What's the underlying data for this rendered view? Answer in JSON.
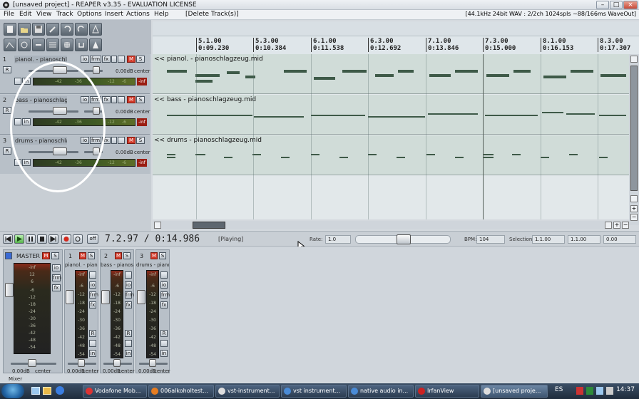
{
  "window": {
    "title": "[unsaved project] - REAPER v3.35 - EVALUATION LICENSE",
    "minimize_label": "–",
    "maximize_label": "□",
    "close_label": "×"
  },
  "menu": {
    "items": [
      "File",
      "Edit",
      "View",
      "Track",
      "Options",
      "Insert",
      "Actions",
      "Help"
    ],
    "action_hint": "[Delete Track(s)]",
    "audio_status": "[44.1kHz 24bit WAV : 2/2ch 1024spls ~88/166ms WaveOut]"
  },
  "ruler": {
    "markers": [
      {
        "bar": "5.1.00",
        "time": "0:09.230"
      },
      {
        "bar": "5.3.00",
        "time": "0:10.384"
      },
      {
        "bar": "6.1.00",
        "time": "0:11.538"
      },
      {
        "bar": "6.3.00",
        "time": "0:12.692"
      },
      {
        "bar": "7.1.00",
        "time": "0:13.846"
      },
      {
        "bar": "7.3.00",
        "time": "0:15.000"
      },
      {
        "bar": "8.1.00",
        "time": "0:16.153"
      },
      {
        "bar": "8.3.00",
        "time": "0:17.307"
      }
    ]
  },
  "tracks": [
    {
      "num": "1",
      "name": "pianol. - pianoschlagzeu",
      "volume": "0.00dB",
      "pan": "center",
      "item": "<< pianol. - pianoschlagzeug.mid",
      "inf": "-inf",
      "meter_ticks": [
        "-42",
        "-36",
        "-12",
        "-6"
      ]
    },
    {
      "num": "2",
      "name": "bass - pianoschlagzeu",
      "volume": "0.00dB",
      "pan": "center",
      "item": "<< bass - pianoschlagzeug.mid",
      "inf": "-inf",
      "meter_ticks": [
        "-42",
        "-36",
        "-12",
        "-6"
      ]
    },
    {
      "num": "3",
      "name": "drums - pianoschlagze",
      "volume": "0.00dB",
      "pan": "center",
      "item": "<< drums - pianoschlagzeug.mid",
      "inf": "-inf",
      "meter_ticks": [
        "-42",
        "-36",
        "-12",
        "-6"
      ]
    }
  ],
  "track_buttons": {
    "io": "io",
    "fx_env": "frm",
    "fx": "fx",
    "mute": "M",
    "solo": "S",
    "rec": "R",
    "input": "in"
  },
  "transport": {
    "time": "7.2.97 / 0:14.986",
    "state": "[Playing]",
    "rate_label": "Rate:",
    "rate_value": "1.0",
    "bpm_label": "BPM:",
    "bpm_value": "104",
    "selection_label": "Selection:",
    "sel_start": "1.1.00",
    "sel_end": "1.1.00",
    "sel_len": "0.00",
    "off_label": "off"
  },
  "mixer": {
    "master": {
      "name": "MASTER",
      "inf_l": "-inf",
      "inf_r": "-inf",
      "pan": "center",
      "vol": "0.00dB",
      "scale": [
        "12",
        "6",
        "-6",
        "-12",
        "-18",
        "-24",
        "-30",
        "-36",
        "-42",
        "-48",
        "-54",
        "-inf"
      ],
      "io": "io",
      "fx": "fx",
      "env": "frm"
    },
    "strips": [
      {
        "num": "1",
        "name": "pianol. - piano",
        "inf": "-inf",
        "vol": "0.00dB",
        "pan": "center"
      },
      {
        "num": "2",
        "name": "bass - pianos",
        "inf": "-inf",
        "vol": "0.00dB",
        "pan": "center"
      },
      {
        "num": "3",
        "name": "drums - piano",
        "inf": "-inf",
        "vol": "0.00dB",
        "pan": "center"
      }
    ],
    "strip_scale": [
      "-6",
      "-12",
      "-18",
      "-24",
      "-30",
      "-36",
      "-42",
      "-48",
      "-54"
    ],
    "label": "Mixer"
  },
  "taskbar": {
    "tasks": [
      {
        "label": "Vodafone Mob...",
        "color": "#d33"
      },
      {
        "label": "006alkoholtest...",
        "color": "#e67d22"
      },
      {
        "label": "vst-instrument...",
        "color": "#ddd"
      },
      {
        "label": "vst instrument...",
        "color": "#4a8bd6"
      },
      {
        "label": "native audio in...",
        "color": "#4a8bd6"
      },
      {
        "label": "IrfanView",
        "color": "#c22"
      },
      {
        "label": "[unsaved proje...",
        "color": "#ddd"
      }
    ],
    "lang": "ES",
    "clock": "14:37"
  },
  "colors": {
    "mute": "#d23a2a",
    "note": "#3e5a48",
    "annotation": "#ffffff"
  },
  "icons": [
    "new-project-icon",
    "open-icon",
    "save-icon",
    "settings-icon",
    "undo-icon",
    "redo-icon",
    "metronome-icon",
    "envelope-icon",
    "grid-icon",
    "snap-icon",
    "ripple-icon",
    "lock-icon",
    "loop-icon"
  ]
}
